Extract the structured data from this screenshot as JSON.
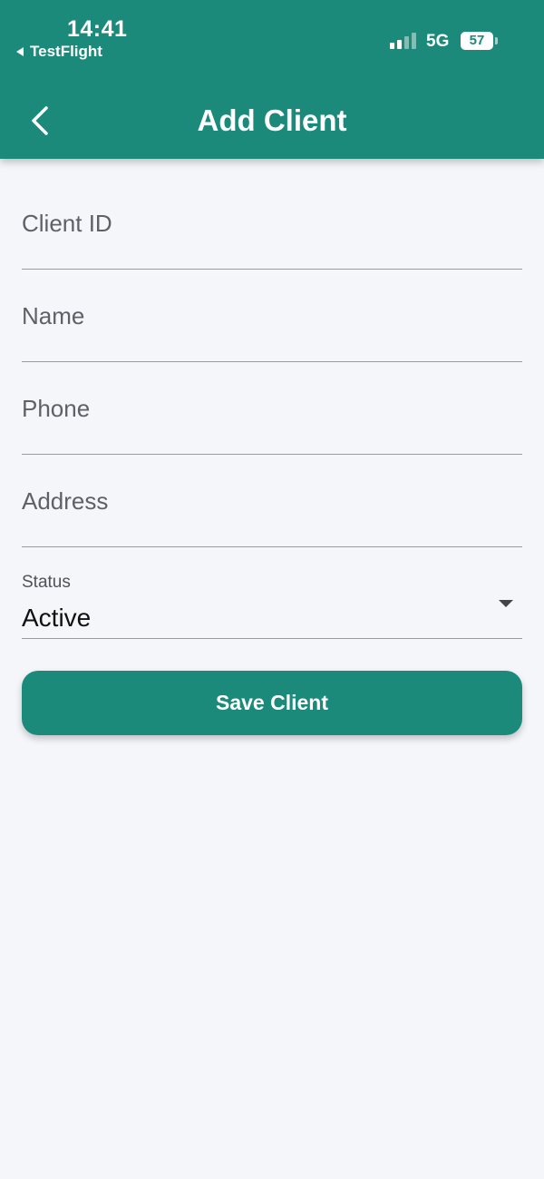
{
  "status_bar": {
    "time": "14:41",
    "back_app": "TestFlight",
    "network": "5G",
    "battery": "57"
  },
  "header": {
    "title": "Add Client",
    "back_icon": "chevron-left-icon"
  },
  "form": {
    "fields": [
      {
        "placeholder": "Client ID",
        "value": ""
      },
      {
        "placeholder": "Name",
        "value": ""
      },
      {
        "placeholder": "Phone",
        "value": ""
      },
      {
        "placeholder": "Address",
        "value": ""
      }
    ],
    "status": {
      "label": "Status",
      "value": "Active"
    }
  },
  "actions": {
    "save_label": "Save Client"
  },
  "colors": {
    "primary": "#1b8a7a",
    "background": "#f4f6fa"
  }
}
